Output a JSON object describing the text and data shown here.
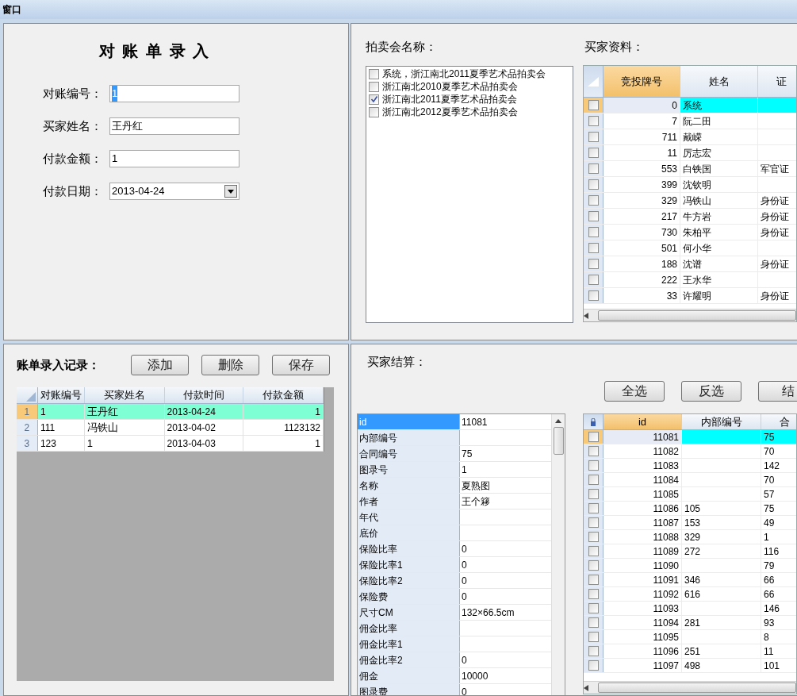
{
  "window": {
    "title": "窗口"
  },
  "entry_form": {
    "title": "对 账 单 录 入",
    "fields": [
      {
        "label": "对账编号：",
        "value": "1",
        "kind": "text",
        "text_selected": true
      },
      {
        "label": "买家姓名：",
        "value": "王丹红",
        "kind": "text",
        "text_selected": false
      },
      {
        "label": "付款金额：",
        "value": "1",
        "kind": "text",
        "text_selected": false
      },
      {
        "label": "付款日期：",
        "value": "2013-04-24",
        "kind": "dropdown",
        "text_selected": false
      }
    ]
  },
  "records": {
    "label": "账单录入记录：",
    "buttons": [
      "添加",
      "删除",
      "保存"
    ],
    "table": {
      "columns": [
        "对账编号",
        "买家姓名",
        "付款时间",
        "付款金额"
      ],
      "rows": [
        {
          "number": "1",
          "selected": true,
          "cells": [
            "1",
            "王丹红",
            "2013-04-24",
            "1"
          ]
        },
        {
          "number": "2",
          "selected": false,
          "cells": [
            "111",
            "冯铁山",
            "2013-04-02",
            "1123132"
          ]
        },
        {
          "number": "3",
          "selected": false,
          "cells": [
            "123",
            "1",
            "2013-04-03",
            "1"
          ]
        }
      ]
    }
  },
  "auction": {
    "label": "拍卖会名称：",
    "items": [
      {
        "label": "系统，浙江南北2011夏季艺术品拍卖会",
        "checked": false
      },
      {
        "label": "浙江南北2010夏季艺术品拍卖会",
        "checked": false
      },
      {
        "label": "浙江南北2011夏季艺术品拍卖会",
        "checked": true
      },
      {
        "label": "浙江南北2012夏季艺术品拍卖会",
        "checked": false
      }
    ]
  },
  "buyers": {
    "label": "买家资料：",
    "columns": [
      {
        "label": "竞投牌号",
        "selected": true
      },
      {
        "label": "姓名",
        "selected": false
      },
      {
        "label": "证",
        "selected": false
      }
    ],
    "rows": [
      {
        "checked": false,
        "selected": true,
        "cells": [
          "0",
          "系统",
          null
        ]
      },
      {
        "checked": false,
        "selected": false,
        "cells": [
          "7",
          "阮二田",
          null
        ]
      },
      {
        "checked": false,
        "selected": false,
        "cells": [
          "711",
          "戴嵘",
          null
        ]
      },
      {
        "checked": false,
        "selected": false,
        "cells": [
          "11",
          "厉志宏",
          null
        ]
      },
      {
        "checked": false,
        "selected": false,
        "cells": [
          "553",
          "白铁国",
          "军官证"
        ]
      },
      {
        "checked": false,
        "selected": false,
        "cells": [
          "399",
          "沈钦明",
          null
        ]
      },
      {
        "checked": false,
        "selected": false,
        "cells": [
          "329",
          "冯铁山",
          "身份证"
        ]
      },
      {
        "checked": false,
        "selected": false,
        "cells": [
          "217",
          "牛方岩",
          "身份证"
        ]
      },
      {
        "checked": false,
        "selected": false,
        "cells": [
          "730",
          "朱柏平",
          "身份证"
        ]
      },
      {
        "checked": false,
        "selected": false,
        "cells": [
          "501",
          "何小华",
          null
        ]
      },
      {
        "checked": false,
        "selected": false,
        "cells": [
          "188",
          "沈谱",
          "身份证"
        ]
      },
      {
        "checked": false,
        "selected": false,
        "cells": [
          "222",
          "王水华",
          null
        ]
      },
      {
        "checked": false,
        "selected": false,
        "cells": [
          "33",
          "许耀明",
          "身份证"
        ]
      }
    ]
  },
  "settlement": {
    "label": "买家结算：",
    "buttons": [
      "全选",
      "反选",
      "结"
    ],
    "properties": [
      {
        "name": "id",
        "value": "11081",
        "selected": true
      },
      {
        "name": "内部编号",
        "selected": false
      },
      {
        "name": "合同编号",
        "value": "75",
        "selected": false
      },
      {
        "name": "图录号",
        "value": "1",
        "selected": false
      },
      {
        "name": "名称",
        "value": "夏熟图",
        "selected": false
      },
      {
        "name": "作者",
        "value": "王个簃",
        "selected": false
      },
      {
        "name": "年代",
        "selected": false
      },
      {
        "name": "底价",
        "selected": false
      },
      {
        "name": "保险比率",
        "value": "0",
        "selected": false
      },
      {
        "name": "保险比率1",
        "value": "0",
        "selected": false
      },
      {
        "name": "保险比率2",
        "value": "0",
        "selected": false
      },
      {
        "name": "保险费",
        "value": "0",
        "selected": false
      },
      {
        "name": "尺寸CM",
        "value": "132×66.5cm",
        "selected": false
      },
      {
        "name": "佣金比率",
        "selected": false
      },
      {
        "name": "佣金比率1",
        "selected": false
      },
      {
        "name": "佣金比率2",
        "value": "0",
        "selected": false
      },
      {
        "name": "佣金",
        "value": "10000",
        "selected": false
      },
      {
        "name": "图录费",
        "value": "0",
        "selected": false
      }
    ],
    "grid": {
      "columns": [
        {
          "label": "id",
          "selected": true
        },
        {
          "label": "内部编号",
          "selected": false
        },
        {
          "label": "合",
          "selected": false
        }
      ],
      "rows": [
        {
          "checked": false,
          "selected": true,
          "cells": [
            "11081",
            null,
            "75"
          ]
        },
        {
          "checked": false,
          "selected": false,
          "cells": [
            "11082",
            null,
            "70"
          ]
        },
        {
          "checked": false,
          "selected": false,
          "cells": [
            "11083",
            null,
            "142"
          ]
        },
        {
          "checked": false,
          "selected": false,
          "cells": [
            "11084",
            null,
            "70"
          ]
        },
        {
          "checked": false,
          "selected": false,
          "cells": [
            "11085",
            null,
            "57"
          ]
        },
        {
          "checked": false,
          "selected": false,
          "cells": [
            "11086",
            "105",
            "75"
          ]
        },
        {
          "checked": false,
          "selected": false,
          "cells": [
            "11087",
            "153",
            "49"
          ]
        },
        {
          "checked": false,
          "selected": false,
          "cells": [
            "11088",
            "329",
            "1"
          ]
        },
        {
          "checked": false,
          "selected": false,
          "cells": [
            "11089",
            "272",
            "116"
          ]
        },
        {
          "checked": false,
          "selected": false,
          "cells": [
            "11090",
            null,
            "79"
          ]
        },
        {
          "checked": false,
          "selected": false,
          "cells": [
            "11091",
            "346",
            "66"
          ]
        },
        {
          "checked": false,
          "selected": false,
          "cells": [
            "11092",
            "616",
            "66"
          ]
        },
        {
          "checked": false,
          "selected": false,
          "cells": [
            "11093",
            null,
            "146"
          ]
        },
        {
          "checked": false,
          "selected": false,
          "cells": [
            "11094",
            "281",
            "93"
          ]
        },
        {
          "checked": false,
          "selected": false,
          "cells": [
            "11095",
            null,
            "8"
          ]
        },
        {
          "checked": false,
          "selected": false,
          "cells": [
            "11096",
            "251",
            "11"
          ]
        },
        {
          "checked": false,
          "selected": false,
          "cells": [
            "11097",
            "498",
            "101"
          ]
        }
      ]
    }
  }
}
